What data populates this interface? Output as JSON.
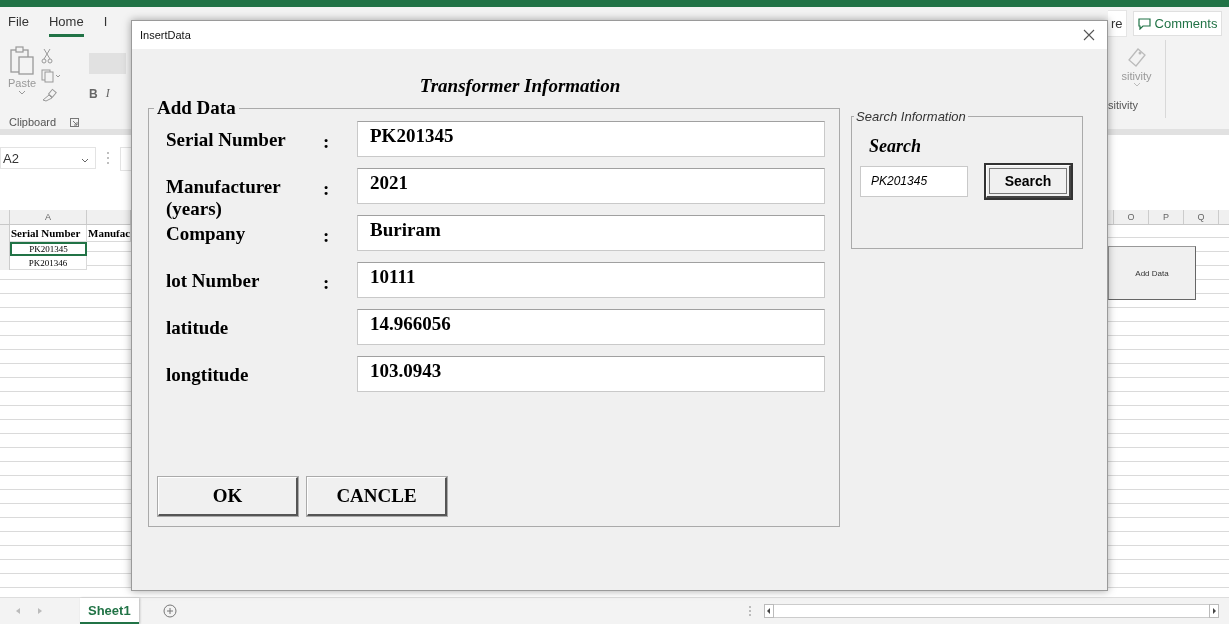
{
  "excel": {
    "ribbon_tabs": [
      {
        "label": "File",
        "selected": false
      },
      {
        "label": "Home",
        "selected": true
      },
      {
        "label": "I",
        "selected": false
      }
    ],
    "share_button": "re",
    "comments_button": "Comments",
    "clipboard": {
      "paste": "Paste",
      "group_label": "Clipboard"
    },
    "font_buttons": [
      "B",
      "I"
    ],
    "sensitivity": {
      "button": "sitivity",
      "group_label": "sitivity"
    },
    "name_box": "A2",
    "left_columns": [
      "A"
    ],
    "right_columns": [
      "O",
      "P",
      "Q"
    ],
    "header_cells": [
      "Serial Number",
      "Manufac"
    ],
    "data_rows": [
      {
        "value": "PK201345",
        "selected": true
      },
      {
        "value": "PK201346",
        "selected": false
      }
    ],
    "add_data_button": "Add Data",
    "sheet_tabs": [
      {
        "label": "Sheet1",
        "selected": true
      }
    ]
  },
  "dialog": {
    "title": "InsertData",
    "heading": "Transformer Information",
    "add_frame": {
      "title": "Add Data",
      "fields": [
        {
          "label": "Serial Number",
          "colon": ":",
          "value": "PK201345"
        },
        {
          "label": "Manufacturer (years)",
          "colon": ":",
          "value": "2021"
        },
        {
          "label": "Company",
          "colon": ":",
          "value": "Buriram"
        },
        {
          "label": "lot Number",
          "colon": ":",
          "value": "10111"
        },
        {
          "label": "latitude",
          "value": "14.966056"
        },
        {
          "label": "longtitude",
          "value": "103.0943"
        }
      ],
      "buttons": [
        {
          "label": "OK"
        },
        {
          "label": "CANCLE"
        }
      ]
    },
    "search_frame": {
      "title": "Search Information",
      "label": "Search",
      "value": "PK201345",
      "button": "Search",
      "button_focused": true
    }
  }
}
